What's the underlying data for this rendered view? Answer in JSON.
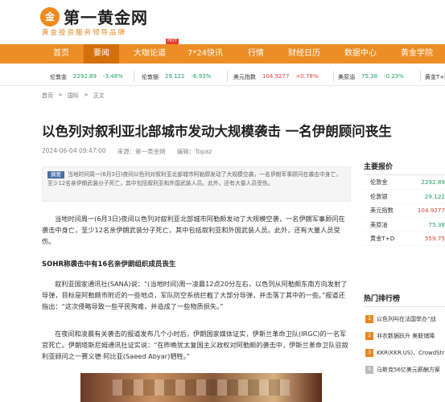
{
  "header": {
    "logo_mark": "金",
    "logo_text": "第一黄金网",
    "slogan": "黄金投资服务领导品牌"
  },
  "nav": {
    "items": [
      {
        "label": "首页"
      },
      {
        "label": "要闻",
        "active": true
      },
      {
        "label": "大咖论道",
        "badge": "HOT"
      },
      {
        "label": "7*24快讯"
      },
      {
        "label": "行情"
      },
      {
        "label": "财经日历"
      },
      {
        "label": "数据中心"
      },
      {
        "label": "黄金学院"
      }
    ]
  },
  "ticker": [
    {
      "name": "伦敦金",
      "value": "2292.89",
      "change": "-3.48%",
      "dir": "dn"
    },
    {
      "name": "伦敦银",
      "value": "29.122",
      "change": "-6.93%",
      "dir": "dn"
    },
    {
      "name": "美元指数",
      "value": "104.9277",
      "change": "+0.78%",
      "dir": "up"
    },
    {
      "name": "美原油",
      "value": "75.38",
      "change": "-0.23%",
      "dir": "dn"
    },
    {
      "name": "黄金T+D",
      "value": "",
      "change": "",
      "dir": "dn"
    }
  ],
  "breadcrumb": [
    "首页",
    ">",
    "国际",
    ">",
    "正文"
  ],
  "article": {
    "title": "以色列对叙利亚北部城市发动大规模袭击 一名伊朗顾问丧生",
    "date": "2024-06-04 09:47:00",
    "source": "来源：第一黄金网",
    "author": "编辑：Topaz",
    "summary_tag": "摘要",
    "summary": "当地时间周一(6月3日)夜间以色列对叙利亚北部城市阿勒颇发动了大规模空袭，一名伊朗军事顾问在袭击中身亡，至少12名亲伊朗武装分子死亡，其中包括叙利亚和外国武装人员。此外，还有大量人员受伤。",
    "p1": "当地时间周一(6月3日)夜间以色列对叙利亚北部城市阿勒颇发动了大规模空袭，一名伊朗军事顾问在袭击中身亡，至少12名亲伊朗武装分子死亡，其中包括叙利亚和外国武装人员。此外，还有大量人员受伤。",
    "h2": "SOHR称袭击中有16名亲伊朗组织成员丧生",
    "p2": "叙利亚国家通讯社(SANA)说：“(当地时间)周一凌晨12点20分左右，以色列从阿勒颇东南方向发射了导弹，目标是阿勒颇市附近的一些地点，军队防空系统拦截了大部分导弹，并击落了其中的一些。”报道还指出：“这次侵略导致一些平民殉难，并造成了一些物质损失。”",
    "p3": "在夜间和凌晨有关袭击的报道发布几个小时后，伊朗国家媒体证实，伊斯兰革命卫队(IRGC)的一名军官死亡。伊朗塔斯尼姆通讯社证实说：“在昨晚犹太复国主义政权对阿勒颇的袭击中，伊斯兰革命卫队驻叙利亚顾问之一赛义德·阿比亚(Saeed Abyar)牺牲。”"
  },
  "sidebar": {
    "quotes_title": "主要报价",
    "quotes": [
      {
        "name": "伦敦金",
        "value": "2292.89",
        "dir": "dn"
      },
      {
        "name": "伦敦银",
        "value": "29.122",
        "dir": "dn"
      },
      {
        "name": "美元指数",
        "value": "104.9277",
        "dir": "up"
      },
      {
        "name": "美原油",
        "value": "75.38",
        "dir": "dn"
      },
      {
        "name": "黄金T+D",
        "value": "559.75",
        "dir": "up"
      }
    ],
    "rank_title": "热门排行榜",
    "rank": [
      {
        "num": "1",
        "text": "以色列叫在法国举办“战"
      },
      {
        "num": "2",
        "text": "非农数据跃升 美联储降"
      },
      {
        "num": "3",
        "text": "KKR(KKR.US)、CrowdStr"
      },
      {
        "num": "4",
        "text": "马斯克56亿美元薪酬方案"
      }
    ]
  }
}
